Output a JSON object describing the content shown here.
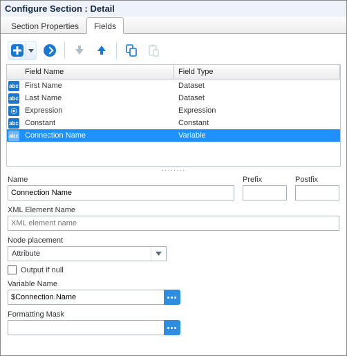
{
  "title": "Configure Section : Detail",
  "tabs": [
    {
      "label": "Section Properties",
      "active": false
    },
    {
      "label": "Fields",
      "active": true
    }
  ],
  "toolbar": {
    "icons": [
      "add-icon",
      "dropdown-caret-icon",
      "delete-icon",
      "move-down-icon",
      "move-up-icon",
      "copy-icon",
      "paste-icon"
    ]
  },
  "table": {
    "columns": [
      {
        "key": "name",
        "label": "Field Name"
      },
      {
        "key": "type",
        "label": "Field Type"
      }
    ],
    "rows": [
      {
        "icon": "abc-icon",
        "name": "First Name",
        "type": "Dataset",
        "selected": false
      },
      {
        "icon": "abc-icon",
        "name": "Last Name",
        "type": "Dataset",
        "selected": false
      },
      {
        "icon": "expression-icon",
        "name": "Expression",
        "type": "Expression",
        "selected": false
      },
      {
        "icon": "abc-icon",
        "name": "Constant",
        "type": "Constant",
        "selected": false
      },
      {
        "icon": "abc-icon",
        "name": "Connection Name",
        "type": "Variable",
        "selected": true
      }
    ]
  },
  "form": {
    "name": {
      "label": "Name",
      "value": "Connection Name"
    },
    "prefix": {
      "label": "Prefix",
      "value": ""
    },
    "postfix": {
      "label": "Postfix",
      "value": ""
    },
    "xml_element": {
      "label": "XML Element Name",
      "placeholder": "XML element name",
      "value": ""
    },
    "node_placement": {
      "label": "Node placement",
      "value": "Attribute"
    },
    "output_if_null": {
      "label": "Output if null",
      "checked": false
    },
    "variable_name": {
      "label": "Variable Name",
      "value": "$Connection.Name"
    },
    "formatting_mask": {
      "label": "Formatting Mask",
      "value": ""
    }
  }
}
